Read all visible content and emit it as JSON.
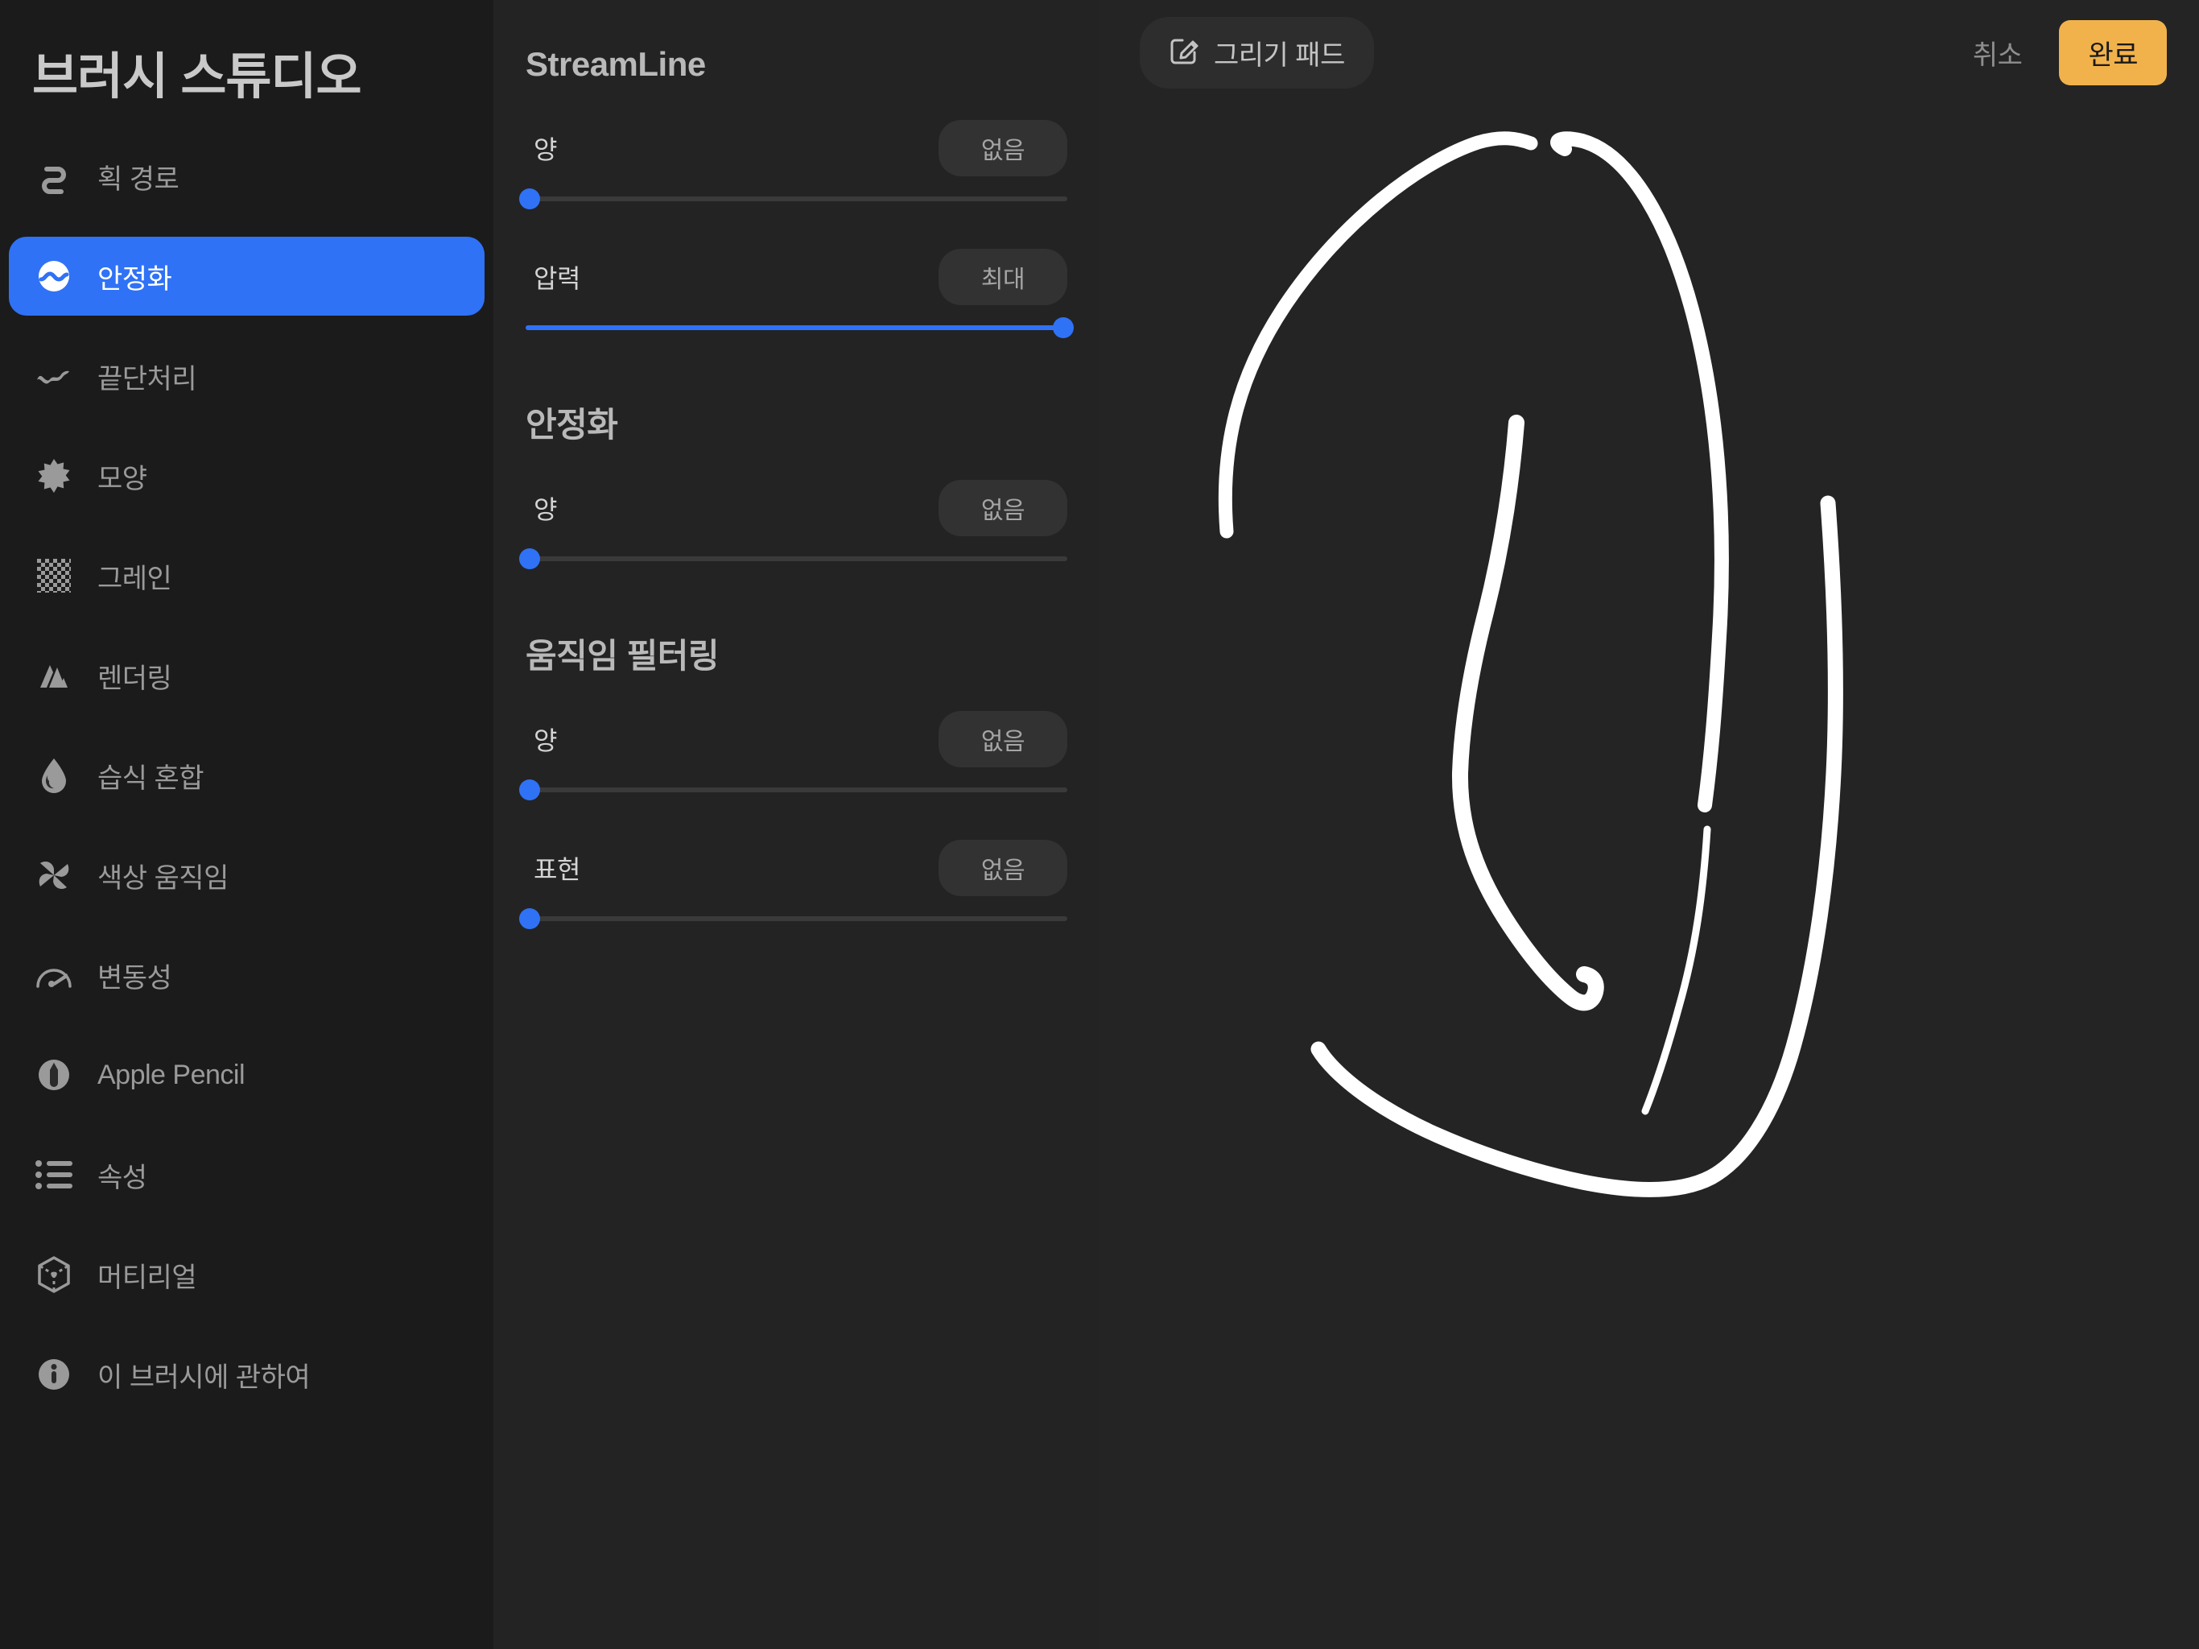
{
  "app": {
    "title": "브러시 스튜디오",
    "accent_blue": "#2f72f5",
    "accent_amber": "#f2b24b",
    "sidebar_bg": "#1b1b1b",
    "settings_bg": "#232323",
    "canvas_bg": "#242424",
    "stroke_color": "#ffffff"
  },
  "sidebar": {
    "items": [
      {
        "label": "획 경로",
        "icon": "stroke-path-icon",
        "active": false
      },
      {
        "label": "안정화",
        "icon": "stabilization-icon",
        "active": true
      },
      {
        "label": "끝단처리",
        "icon": "taper-icon",
        "active": false
      },
      {
        "label": "모양",
        "icon": "shape-icon",
        "active": false
      },
      {
        "label": "그레인",
        "icon": "grain-icon",
        "active": false
      },
      {
        "label": "렌더링",
        "icon": "rendering-icon",
        "active": false
      },
      {
        "label": "습식 혼합",
        "icon": "wet-mix-icon",
        "active": false
      },
      {
        "label": "색상 움직임",
        "icon": "color-dynamics-icon",
        "active": false
      },
      {
        "label": "변동성",
        "icon": "variability-icon",
        "active": false
      },
      {
        "label": "Apple Pencil",
        "icon": "apple-pencil-icon",
        "active": false
      },
      {
        "label": "속성",
        "icon": "properties-icon",
        "active": false
      },
      {
        "label": "머티리얼",
        "icon": "material-icon",
        "active": false
      },
      {
        "label": "이 브러시에 관하여",
        "icon": "about-info-icon",
        "active": false
      }
    ]
  },
  "settings": {
    "panel_title": "StreamLine",
    "sections": [
      {
        "id": "streamline",
        "title": null,
        "controls": [
          {
            "label": "양",
            "value": "없음",
            "percent": 0
          },
          {
            "label": "압력",
            "value": "최대",
            "percent": 100
          }
        ]
      },
      {
        "id": "stabilization",
        "title": "안정화",
        "controls": [
          {
            "label": "양",
            "value": "없음",
            "percent": 0
          }
        ]
      },
      {
        "id": "motion-filtering",
        "title": "움직임 필터링",
        "controls": [
          {
            "label": "양",
            "value": "없음",
            "percent": 0
          },
          {
            "label": "표현",
            "value": "없음",
            "percent": 0
          }
        ]
      }
    ]
  },
  "topbar": {
    "drawpad_label": "그리기 패드",
    "drawpad_icon": "pencil-square-icon",
    "cancel_label": "취소",
    "done_label": "완료"
  },
  "canvas": {
    "strokes_description": "freehand white brush strokes forming a large loose loop",
    "stroke_count": 5
  }
}
